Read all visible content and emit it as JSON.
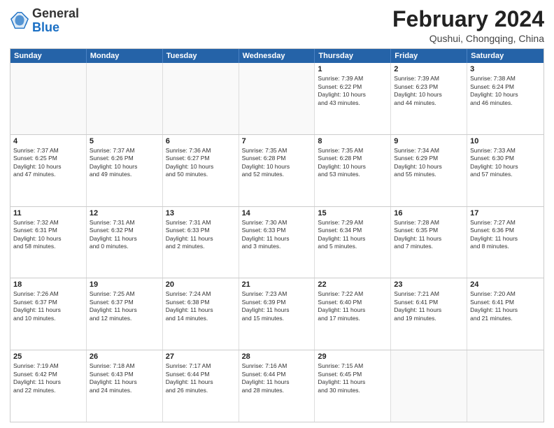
{
  "logo": {
    "general": "General",
    "blue": "Blue"
  },
  "header": {
    "month": "February 2024",
    "location": "Qushui, Chongqing, China"
  },
  "days_of_week": [
    "Sunday",
    "Monday",
    "Tuesday",
    "Wednesday",
    "Thursday",
    "Friday",
    "Saturday"
  ],
  "weeks": [
    [
      {
        "day": "",
        "info": "",
        "empty": true
      },
      {
        "day": "",
        "info": "",
        "empty": true
      },
      {
        "day": "",
        "info": "",
        "empty": true
      },
      {
        "day": "",
        "info": "",
        "empty": true
      },
      {
        "day": "1",
        "info": "Sunrise: 7:39 AM\nSunset: 6:22 PM\nDaylight: 10 hours\nand 43 minutes."
      },
      {
        "day": "2",
        "info": "Sunrise: 7:39 AM\nSunset: 6:23 PM\nDaylight: 10 hours\nand 44 minutes."
      },
      {
        "day": "3",
        "info": "Sunrise: 7:38 AM\nSunset: 6:24 PM\nDaylight: 10 hours\nand 46 minutes."
      }
    ],
    [
      {
        "day": "4",
        "info": "Sunrise: 7:37 AM\nSunset: 6:25 PM\nDaylight: 10 hours\nand 47 minutes."
      },
      {
        "day": "5",
        "info": "Sunrise: 7:37 AM\nSunset: 6:26 PM\nDaylight: 10 hours\nand 49 minutes."
      },
      {
        "day": "6",
        "info": "Sunrise: 7:36 AM\nSunset: 6:27 PM\nDaylight: 10 hours\nand 50 minutes."
      },
      {
        "day": "7",
        "info": "Sunrise: 7:35 AM\nSunset: 6:28 PM\nDaylight: 10 hours\nand 52 minutes."
      },
      {
        "day": "8",
        "info": "Sunrise: 7:35 AM\nSunset: 6:28 PM\nDaylight: 10 hours\nand 53 minutes."
      },
      {
        "day": "9",
        "info": "Sunrise: 7:34 AM\nSunset: 6:29 PM\nDaylight: 10 hours\nand 55 minutes."
      },
      {
        "day": "10",
        "info": "Sunrise: 7:33 AM\nSunset: 6:30 PM\nDaylight: 10 hours\nand 57 minutes."
      }
    ],
    [
      {
        "day": "11",
        "info": "Sunrise: 7:32 AM\nSunset: 6:31 PM\nDaylight: 10 hours\nand 58 minutes."
      },
      {
        "day": "12",
        "info": "Sunrise: 7:31 AM\nSunset: 6:32 PM\nDaylight: 11 hours\nand 0 minutes."
      },
      {
        "day": "13",
        "info": "Sunrise: 7:31 AM\nSunset: 6:33 PM\nDaylight: 11 hours\nand 2 minutes."
      },
      {
        "day": "14",
        "info": "Sunrise: 7:30 AM\nSunset: 6:33 PM\nDaylight: 11 hours\nand 3 minutes."
      },
      {
        "day": "15",
        "info": "Sunrise: 7:29 AM\nSunset: 6:34 PM\nDaylight: 11 hours\nand 5 minutes."
      },
      {
        "day": "16",
        "info": "Sunrise: 7:28 AM\nSunset: 6:35 PM\nDaylight: 11 hours\nand 7 minutes."
      },
      {
        "day": "17",
        "info": "Sunrise: 7:27 AM\nSunset: 6:36 PM\nDaylight: 11 hours\nand 8 minutes."
      }
    ],
    [
      {
        "day": "18",
        "info": "Sunrise: 7:26 AM\nSunset: 6:37 PM\nDaylight: 11 hours\nand 10 minutes."
      },
      {
        "day": "19",
        "info": "Sunrise: 7:25 AM\nSunset: 6:37 PM\nDaylight: 11 hours\nand 12 minutes."
      },
      {
        "day": "20",
        "info": "Sunrise: 7:24 AM\nSunset: 6:38 PM\nDaylight: 11 hours\nand 14 minutes."
      },
      {
        "day": "21",
        "info": "Sunrise: 7:23 AM\nSunset: 6:39 PM\nDaylight: 11 hours\nand 15 minutes."
      },
      {
        "day": "22",
        "info": "Sunrise: 7:22 AM\nSunset: 6:40 PM\nDaylight: 11 hours\nand 17 minutes."
      },
      {
        "day": "23",
        "info": "Sunrise: 7:21 AM\nSunset: 6:41 PM\nDaylight: 11 hours\nand 19 minutes."
      },
      {
        "day": "24",
        "info": "Sunrise: 7:20 AM\nSunset: 6:41 PM\nDaylight: 11 hours\nand 21 minutes."
      }
    ],
    [
      {
        "day": "25",
        "info": "Sunrise: 7:19 AM\nSunset: 6:42 PM\nDaylight: 11 hours\nand 22 minutes."
      },
      {
        "day": "26",
        "info": "Sunrise: 7:18 AM\nSunset: 6:43 PM\nDaylight: 11 hours\nand 24 minutes."
      },
      {
        "day": "27",
        "info": "Sunrise: 7:17 AM\nSunset: 6:44 PM\nDaylight: 11 hours\nand 26 minutes."
      },
      {
        "day": "28",
        "info": "Sunrise: 7:16 AM\nSunset: 6:44 PM\nDaylight: 11 hours\nand 28 minutes."
      },
      {
        "day": "29",
        "info": "Sunrise: 7:15 AM\nSunset: 6:45 PM\nDaylight: 11 hours\nand 30 minutes."
      },
      {
        "day": "",
        "info": "",
        "empty": true
      },
      {
        "day": "",
        "info": "",
        "empty": true
      }
    ]
  ]
}
